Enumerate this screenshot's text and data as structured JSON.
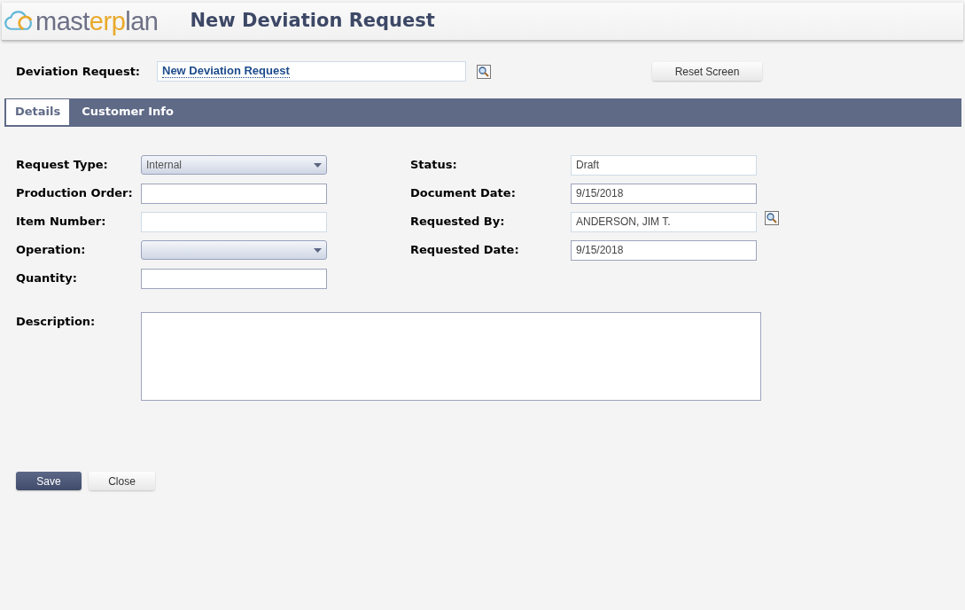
{
  "logo": [
    {
      "text": "mast",
      "accent": false
    },
    {
      "text": "erp",
      "accent": true
    },
    {
      "text": "lan",
      "accent": false
    }
  ],
  "page_title": "New Deviation Request",
  "deviation_request": {
    "label": "Deviation Request:",
    "value": "New Deviation Request"
  },
  "reset_button": "Reset Screen",
  "tabs": [
    {
      "label": "Details",
      "selected": true
    },
    {
      "label": "Customer Info",
      "selected": false
    }
  ],
  "left_fields": [
    {
      "label": "Request Type:",
      "kind": "select",
      "value": "Internal"
    },
    {
      "label": "Production Order:",
      "kind": "text",
      "readonly": false
    },
    {
      "label": "Item Number:",
      "kind": "text",
      "readonly": true
    },
    {
      "label": "Operation:",
      "kind": "select"
    },
    {
      "label": "Quantity:",
      "kind": "text",
      "readonly": false
    }
  ],
  "right_fields": [
    {
      "label": "Status:",
      "kind": "text",
      "value": "Draft",
      "readonly": true,
      "lookup": false
    },
    {
      "label": "Document Date:",
      "kind": "text",
      "value": "9/15/2018",
      "readonly": false,
      "lookup": false
    },
    {
      "label": "Requested By:",
      "kind": "text",
      "value": "ANDERSON, JIM T.",
      "readonly": true,
      "lookup": true
    },
    {
      "label": "Requested Date:",
      "kind": "text",
      "value": "9/15/2018",
      "readonly": false,
      "lookup": false
    }
  ],
  "description": {
    "label": "Description:"
  },
  "buttons": [
    {
      "label": "Save",
      "kind": "primary"
    },
    {
      "label": "Close",
      "kind": "secondary"
    }
  ]
}
